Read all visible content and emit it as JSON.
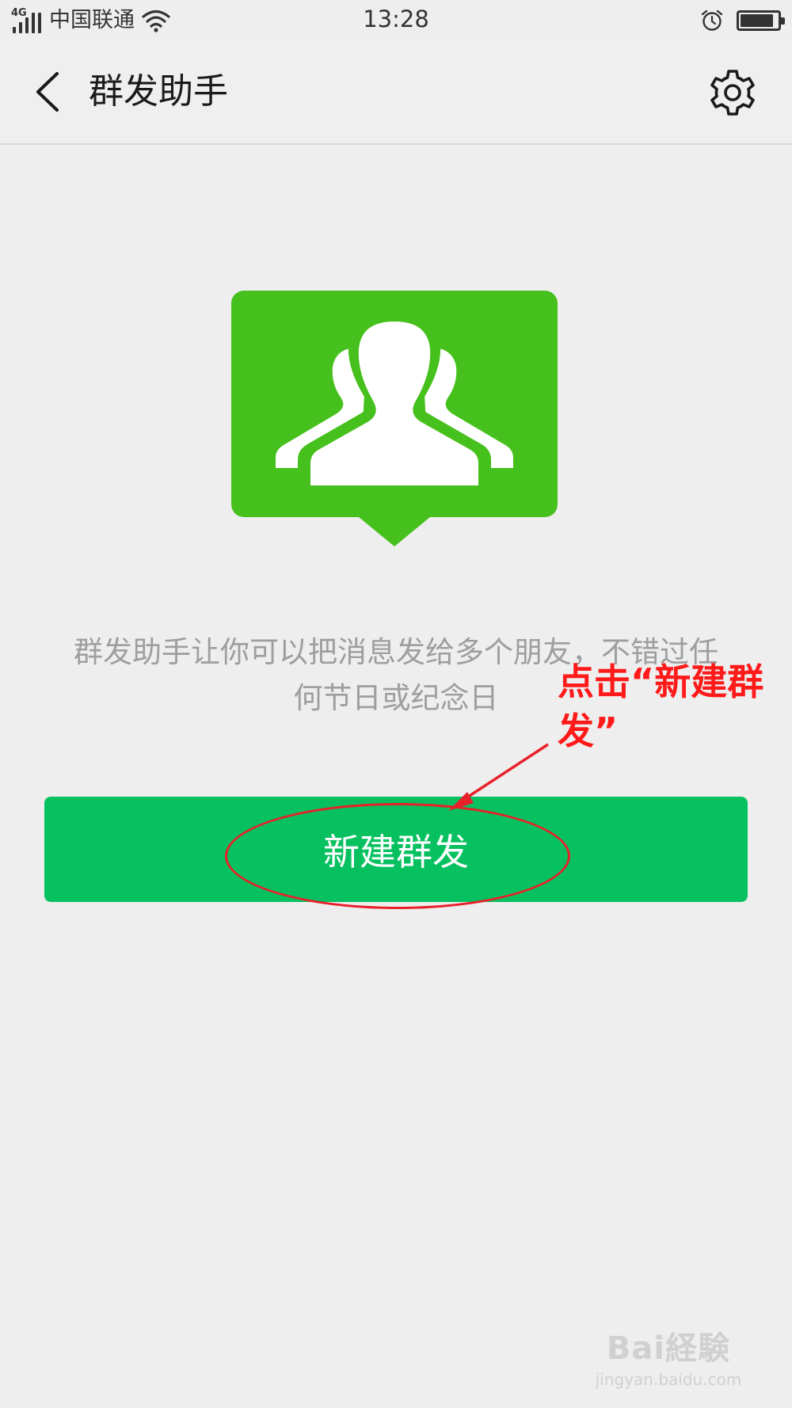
{
  "status_bar": {
    "network_type": "4G",
    "carrier": "中国联通",
    "time": "13:28",
    "battery_level_pct": 90
  },
  "nav": {
    "title": "群发助手",
    "back_icon": "chevron-left-icon",
    "settings_icon": "gear-icon"
  },
  "hero": {
    "icon": "group-chat-icon",
    "color": "#46c01c"
  },
  "description": {
    "line1": "群发助手让你可以把消息发给多个朋友，不错过任",
    "line2": "何节日或纪念日"
  },
  "primary_action": {
    "label": "新建群发",
    "color": "#07c160"
  },
  "annotation": {
    "line1": "点击“新建群",
    "line2": "发”",
    "color": "#ff1a1a"
  },
  "watermark": {
    "logo": "Bai経験",
    "url": "jingyan.baidu.com"
  }
}
